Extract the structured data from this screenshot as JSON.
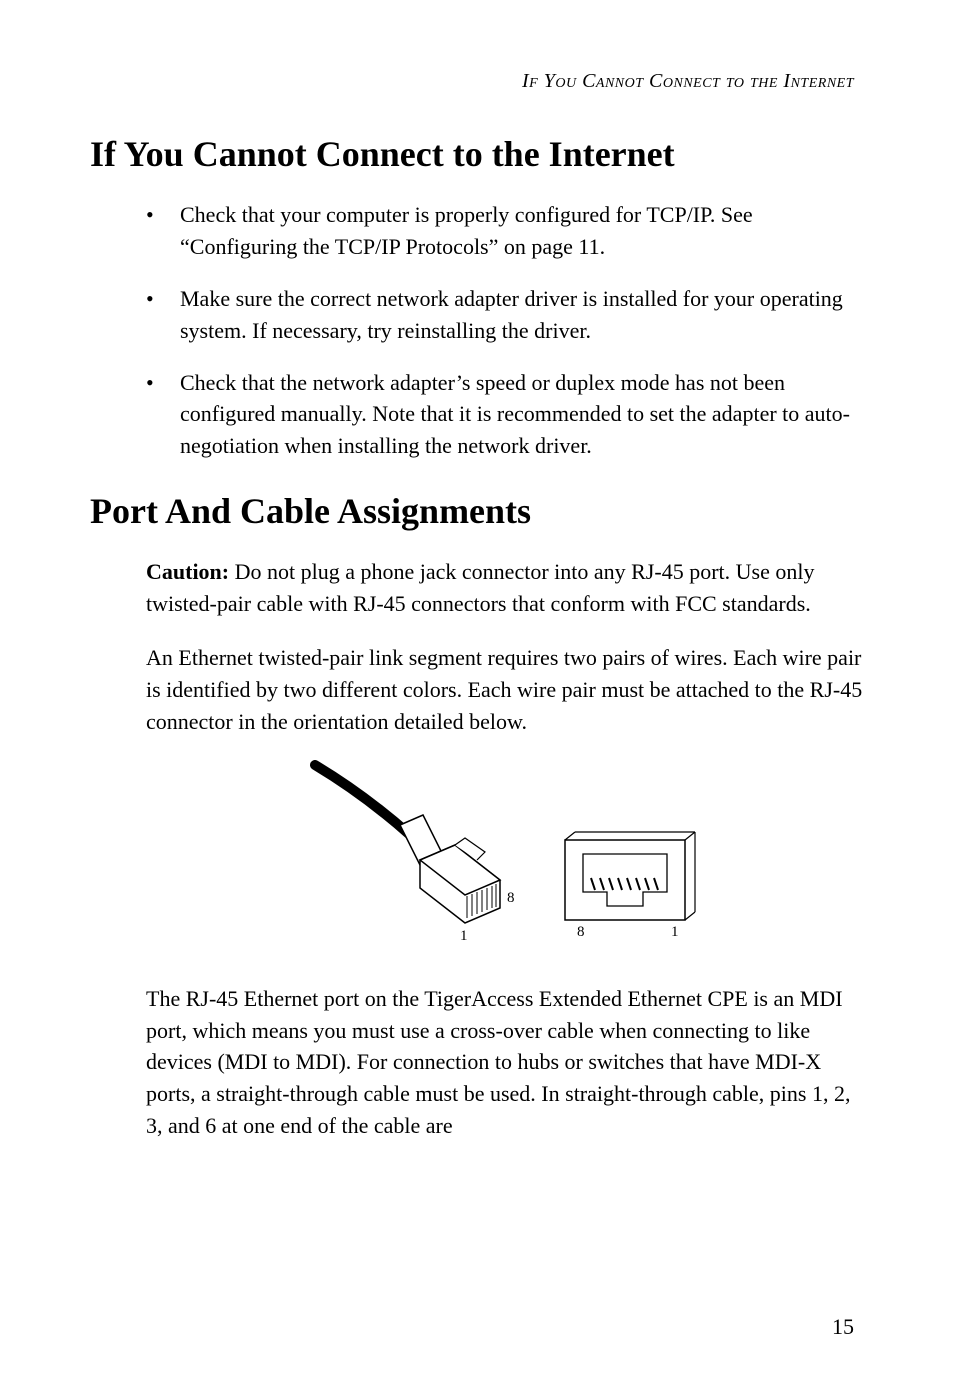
{
  "header": {
    "text": "If You Cannot Connect to the Internet"
  },
  "section1": {
    "title": "If You Cannot Connect to the Internet",
    "bullets": [
      "Check that your computer is properly configured for TCP/IP. See “Configuring the TCP/IP Protocols” on page 11.",
      "Make sure the correct network adapter driver is installed for your operating system. If necessary, try reinstalling the driver.",
      "Check that the network adapter’s speed or duplex mode has not been configured manually. Note that it is recommended to set the adapter to auto-negotiation when installing the network driver."
    ]
  },
  "section2": {
    "title": "Port And Cable Assignments",
    "caution_label": "Caution:",
    "caution_body": " Do not plug a phone jack connector into any RJ-45 port. Use only twisted-pair cable with RJ-45 connectors that conform with FCC standards.",
    "para2": "An Ethernet twisted-pair link segment requires two pairs of wires. Each wire pair is identified by two different colors. Each wire pair must be attached to the RJ-45 connector in the orientation detailed below.",
    "para3": "The RJ-45 Ethernet port on the TigerAccess Extended Ethernet CPE is an MDI port, which means you must use a cross-over cable when connecting to like devices (MDI to MDI). For connection to hubs or switches that have MDI-X ports, a straight-through cable must be used. In straight-through cable, pins 1, 2, 3, and 6 at one end of the cable are"
  },
  "figure": {
    "label_1_left": "1",
    "label_8_left": "8",
    "label_8_right": "8",
    "label_1_right": "1"
  },
  "page": {
    "number": "15"
  }
}
